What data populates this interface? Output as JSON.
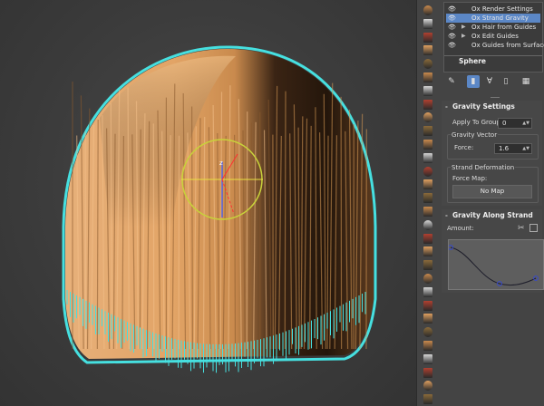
{
  "viewport": {
    "gizmo_axis_label": "z"
  },
  "toolstrip": {
    "tools": [
      "brush-tool-icon",
      "grow-tool-icon",
      "cut-tool-icon",
      "comb-tool-icon",
      "clump-tool-icon",
      "frizz-tool-icon",
      "curl-tool-icon",
      "length-tool-icon",
      "twist-tool-icon",
      "scale-tool-icon",
      "pull-tool-icon",
      "brush-tool-icon",
      "density-tool-icon",
      "color-tool-icon",
      "select-tool-icon",
      "move-tool-icon",
      "cut-tool-icon",
      "paint-tool-icon",
      "smooth-tool-icon",
      "width-tool-icon",
      "brush-tool-icon",
      "pin-tool-icon",
      "lock-tool-icon",
      "erase-tool-icon",
      "sphere-tool-icon",
      "rotate-tool-icon",
      "attach-tool-icon",
      "delete-tool-icon",
      "stamp-tool-icon",
      "clone-tool-icon"
    ]
  },
  "stack": {
    "modifiers": [
      {
        "label": "Ox Render Settings",
        "selected": false,
        "expandable": false
      },
      {
        "label": "Ox Strand Gravity",
        "selected": true,
        "expandable": false
      },
      {
        "label": "Ox Hair from Guides",
        "selected": false,
        "expandable": true
      },
      {
        "label": "Ox Edit Guides",
        "selected": false,
        "expandable": true
      },
      {
        "label": "Ox Guides from Surface",
        "selected": false,
        "expandable": false
      }
    ],
    "object_name": "Sphere"
  },
  "gravity_settings": {
    "title": "Gravity Settings",
    "sign": "-",
    "apply_to_groups_label": "Apply To Groups:",
    "apply_to_groups_value": "0",
    "gravity_vector_label": "Gravity Vector",
    "force_label": "Force:",
    "force_value": "1.6",
    "strand_deformation_label": "Strand Deformation",
    "force_map_label": "Force Map:",
    "force_map_button": "No Map"
  },
  "gravity_along_strand": {
    "title": "Gravity Along Strand",
    "sign": "-",
    "amount_label": "Amount:"
  },
  "colors": {
    "selection": "#5b87c6",
    "hair": "#d99a58",
    "hair_edge": "#44e0e0",
    "gizmo_ring": "#c8d23a"
  }
}
